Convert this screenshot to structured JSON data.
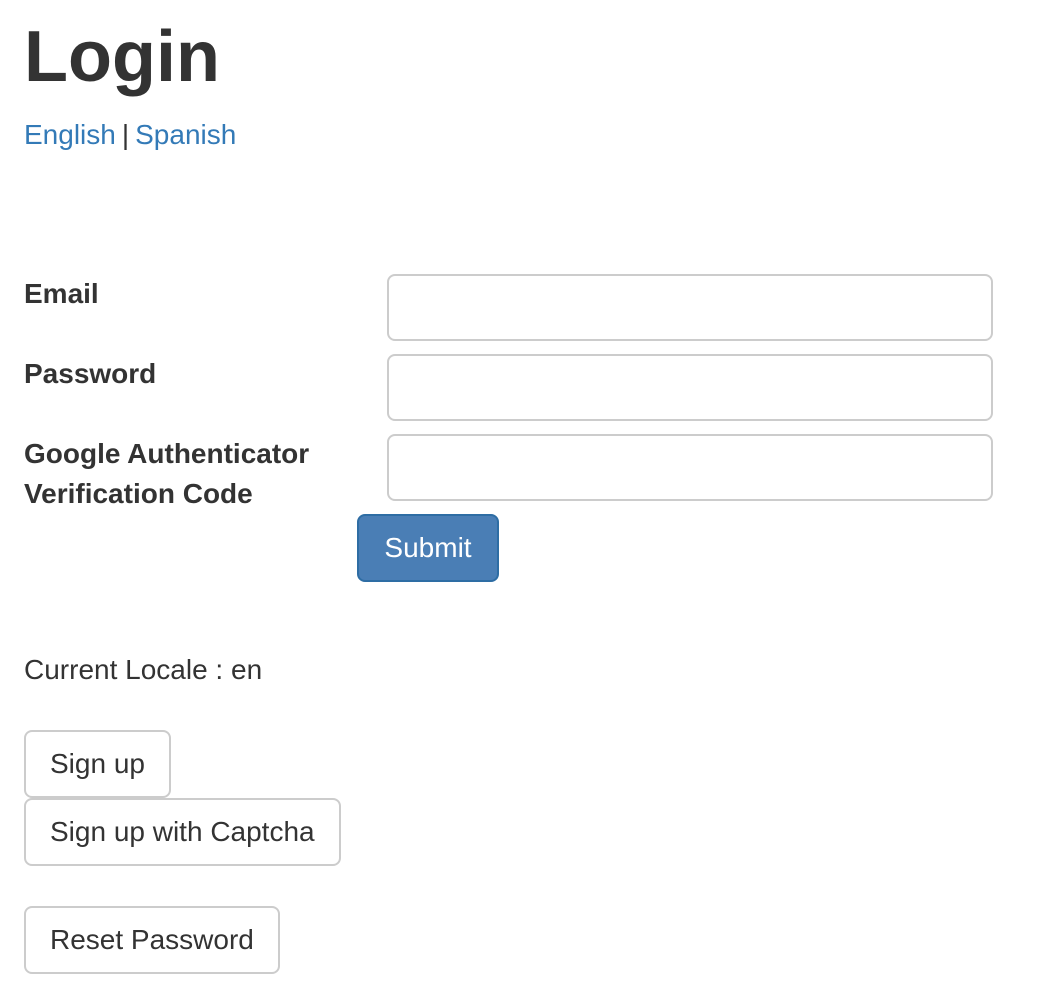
{
  "page": {
    "title": "Login"
  },
  "languages": {
    "english": "English",
    "separator": "|",
    "spanish": "Spanish"
  },
  "form": {
    "email_label": "Email",
    "email_value": "",
    "password_label": "Password",
    "password_value": "",
    "otp_label_line1": "Google Authenticator",
    "otp_label_line2": "Verification Code",
    "otp_value": "",
    "submit_label": "Submit"
  },
  "locale": {
    "text": "Current Locale : en"
  },
  "actions": {
    "signup_label": "Sign up",
    "signup_captcha_label": "Sign up with Captcha",
    "reset_password_label": "Reset Password"
  },
  "colors": {
    "link": "#337ab7",
    "primary_button": "#4a7eb5",
    "text": "#333333",
    "input_border": "#cccccc"
  }
}
